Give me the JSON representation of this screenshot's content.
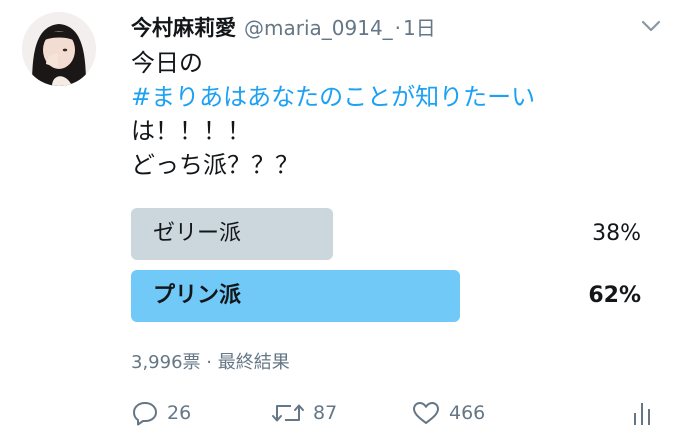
{
  "tweet": {
    "display_name": "今村麻莉愛",
    "handle": "@maria_0914_",
    "separator": "·",
    "time": "1日",
    "text_lines": [
      "今日の",
      "#まりあはあなたのことが知りたーい",
      "は！！！！",
      "どっち派？？？"
    ]
  },
  "poll": {
    "options": [
      {
        "label": "ゼリー派",
        "percent_text": "38%",
        "percent": 38,
        "winner": false
      },
      {
        "label": "プリン派",
        "percent_text": "62%",
        "percent": 62,
        "winner": true
      }
    ],
    "meta": "3,996票 · 最終結果"
  },
  "actions": {
    "reply_count": "26",
    "retweet_count": "87",
    "like_count": "466"
  },
  "icons": {
    "menu": "chevron-down-icon",
    "reply": "reply-icon",
    "retweet": "retweet-icon",
    "like": "heart-icon",
    "analytics": "analytics-icon"
  },
  "colors": {
    "hashtag": "#1da1f2",
    "winner_bar": "#71c9f8",
    "loser_bar": "#ccd6dd",
    "secondary_text": "#657786"
  }
}
